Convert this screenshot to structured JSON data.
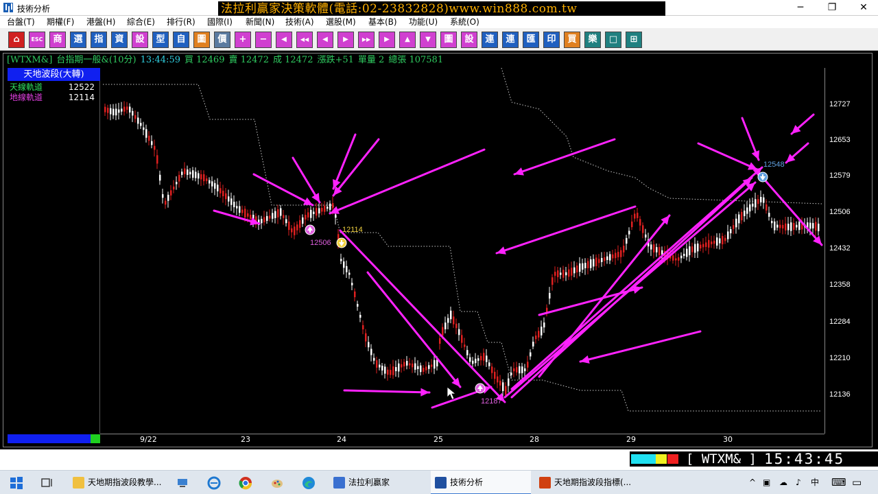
{
  "window": {
    "title": "技術分析",
    "banner": "法拉利贏家決策軟體(電話:02-23832828)www.win888.com.tw",
    "minimize": "─",
    "maximize": "❐",
    "close": "✕"
  },
  "menu": [
    "台盤(T)",
    "期權(F)",
    "港盤(H)",
    "綜合(E)",
    "排行(R)",
    "國際(I)",
    "新聞(N)",
    "技術(A)",
    "選股(M)",
    "基本(B)",
    "功能(U)",
    "系統(O)"
  ],
  "toolbar": [
    "⌂",
    "ESC",
    "商",
    "選",
    "指",
    "資",
    "設",
    "型",
    "自",
    "圖",
    "價",
    "+",
    "−",
    "◀",
    "◀◀",
    "◀",
    "▶",
    "▶▶",
    "▶",
    "▲",
    "▼",
    "圖",
    "設",
    "連",
    "連",
    "匯",
    "印",
    "買",
    "樂",
    "□",
    "⊞"
  ],
  "info": {
    "symbol": "[WTXM&]",
    "name": "台指期一般&(10分)",
    "time": "13:44:59",
    "bid": "買 12469",
    "ask": "賣 12472",
    "deal": "成 12472",
    "change": "漲跌+51",
    "volume": "單量 2",
    "total": "總張 107581"
  },
  "indicator": {
    "header": "天地波段(大轉)",
    "rows": [
      {
        "label": "天線軌道",
        "value": "12522",
        "color": "#30e060"
      },
      {
        "label": "地線軌道",
        "value": "12114",
        "color": "#e040e0"
      }
    ]
  },
  "axis": {
    "y_ticks": [
      "12727",
      "12653",
      "12579",
      "12506",
      "12432",
      "12358",
      "12284",
      "12210",
      "12136"
    ],
    "x_ticks": [
      "9/22",
      "23",
      "24",
      "25",
      "28",
      "29",
      "30"
    ]
  },
  "annotations": {
    "a1": "12506",
    "a2": "12114",
    "a3": "12187",
    "a4": "12548"
  },
  "colors": {
    "arrow": "#ff22ff",
    "up_candle": "#e02020",
    "down_candle": "#ffffff",
    "band": "#cccccc",
    "pink_label": "#e060e0",
    "yellow_label": "#f0d040",
    "blue_label": "#60a0e0"
  },
  "status": {
    "symbol": "[ WTXM& ]",
    "time": "15:43:45"
  },
  "taskbar": {
    "apps": [
      {
        "label": "天地期指波段教學...",
        "color": "#f0c040"
      },
      {
        "label": "法拉利贏家",
        "color": "#3a70d0"
      },
      {
        "label": "技術分析",
        "color": "#2050a0"
      },
      {
        "label": "天地期指波段指標(...",
        "color": "#d04010"
      }
    ],
    "ime": "中",
    "tray_icons": [
      "^",
      "▣",
      "☁",
      "♪"
    ]
  }
}
